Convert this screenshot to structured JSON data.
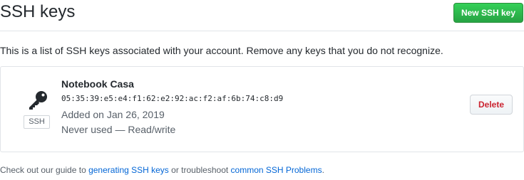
{
  "header": {
    "title": "SSH keys",
    "new_key_label": "New SSH key"
  },
  "intro": "This is a list of SSH keys associated with your account. Remove any keys that you do not recognize.",
  "keys": [
    {
      "icon": "key-icon",
      "type_label": "SSH",
      "title": "Notebook Casa",
      "fingerprint": "05:35:39:e5:e4:f1:62:e2:92:ac:f2:af:6b:74:c8:d9",
      "added_on": "Added on Jan 26, 2019",
      "usage": "Never used — Read/write",
      "delete_label": "Delete"
    }
  ],
  "footer": {
    "prefix": "Check out our guide to ",
    "link1": "generating SSH keys",
    "middle": " or troubleshoot ",
    "link2": "common SSH Problems",
    "suffix": "."
  },
  "colors": {
    "primary_green": "#28a745",
    "danger_red": "#cb2431",
    "link_blue": "#0366d6"
  }
}
